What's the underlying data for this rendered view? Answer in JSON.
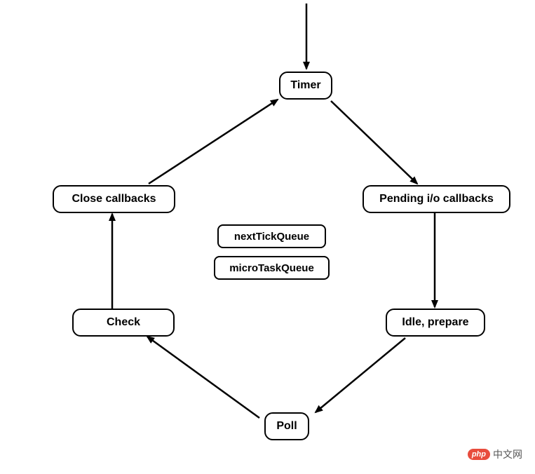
{
  "nodes": {
    "timer": "Timer",
    "pending": "Pending i/o callbacks",
    "idle": "Idle, prepare",
    "poll": "Poll",
    "check": "Check",
    "close": "Close callbacks"
  },
  "center": {
    "nextTick": "nextTickQueue",
    "microTask": "microTaskQueue"
  },
  "watermark": {
    "badge": "php",
    "text": "中文网"
  },
  "chart_data": {
    "type": "flow-diagram",
    "title": "",
    "cycle_nodes": [
      "Timer",
      "Pending i/o callbacks",
      "Idle, prepare",
      "Poll",
      "Check",
      "Close callbacks"
    ],
    "edges": [
      {
        "from": "ENTRY",
        "to": "Timer"
      },
      {
        "from": "Timer",
        "to": "Pending i/o callbacks"
      },
      {
        "from": "Pending i/o callbacks",
        "to": "Idle, prepare"
      },
      {
        "from": "Idle, prepare",
        "to": "Poll"
      },
      {
        "from": "Poll",
        "to": "Check"
      },
      {
        "from": "Check",
        "to": "Close callbacks"
      },
      {
        "from": "Close callbacks",
        "to": "Timer"
      }
    ],
    "center_queues": [
      "nextTickQueue",
      "microTaskQueue"
    ],
    "annotations": []
  }
}
